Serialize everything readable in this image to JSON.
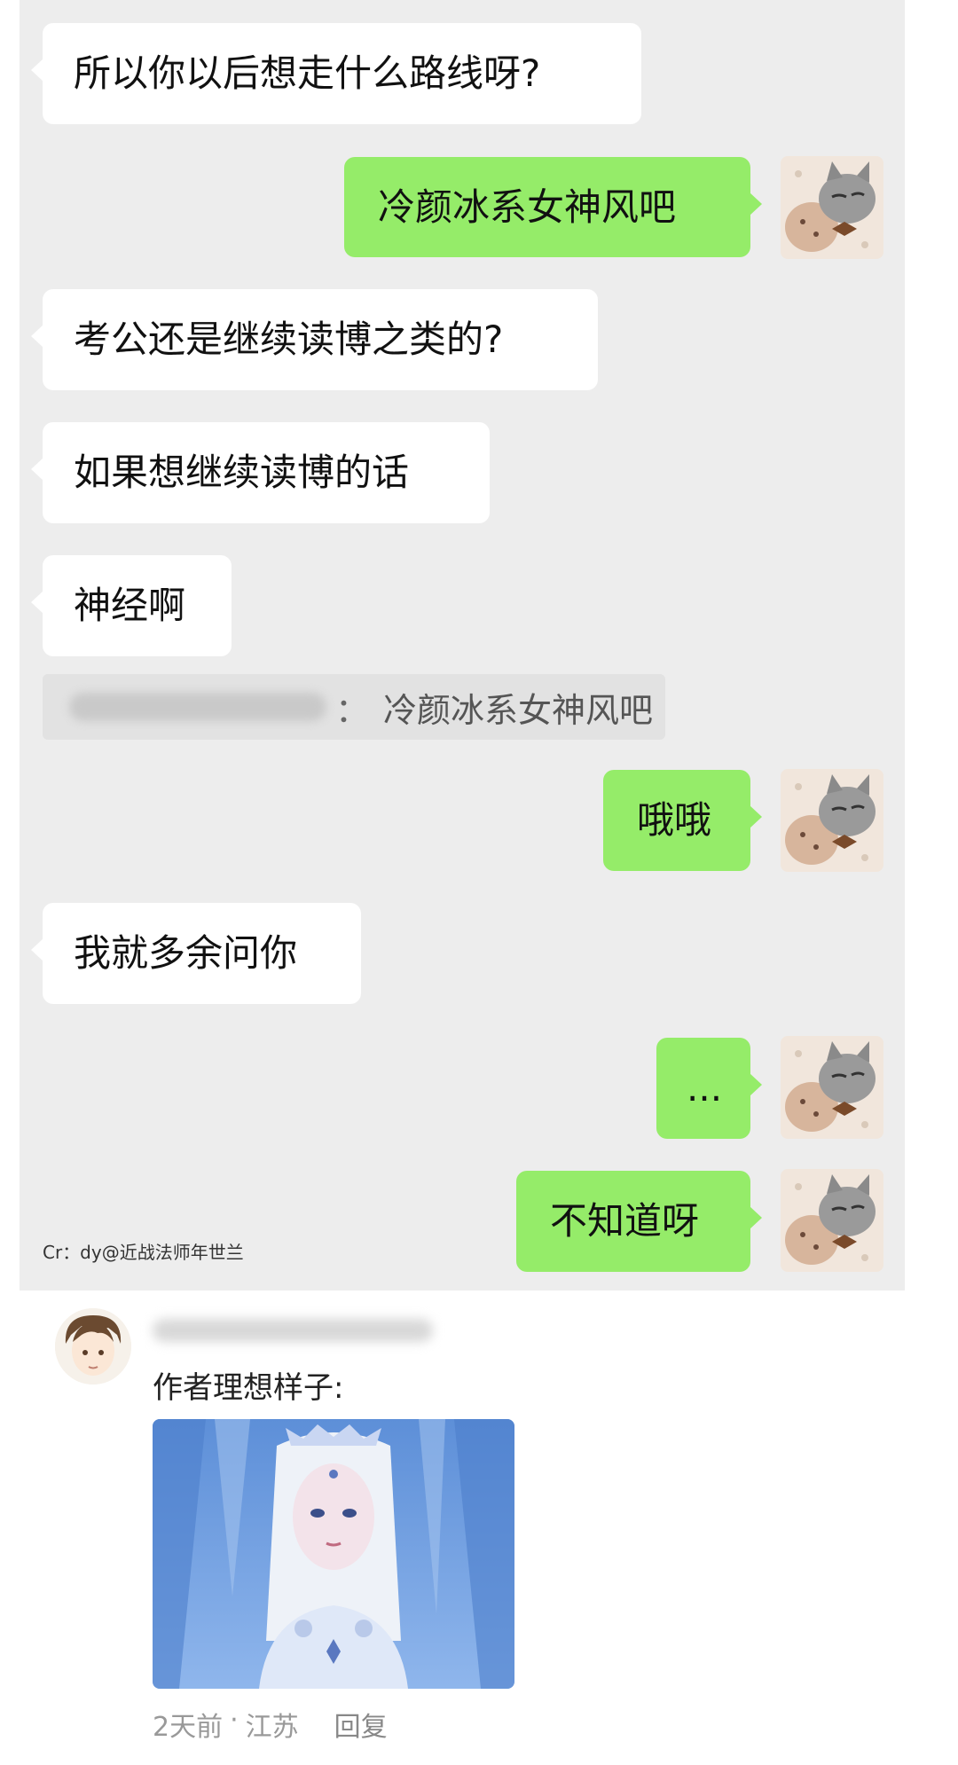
{
  "chat": {
    "messages": [
      {
        "side": "left",
        "text": "所以你以后想走什么路线呀?"
      },
      {
        "side": "right",
        "text": "冷颜冰系女神风吧"
      },
      {
        "side": "left",
        "text": "考公还是继续读博之类的?"
      },
      {
        "side": "left",
        "text": "如果想继续读博的话"
      },
      {
        "side": "left",
        "text": "神经啊"
      },
      {
        "side": "right",
        "text": "哦哦"
      },
      {
        "side": "left",
        "text": "我就多余问你"
      },
      {
        "side": "right",
        "text": "..."
      },
      {
        "side": "right",
        "text": "不知道呀"
      }
    ],
    "quote": {
      "separator": "：",
      "text": "冷颜冰系女神风吧"
    },
    "credit": "Cr：dy@近战法师年世兰",
    "colors": {
      "bubble_right": "#95ec69",
      "bubble_left": "#ffffff",
      "background": "#ededed"
    }
  },
  "comment": {
    "text": "作者理想样子:",
    "time": "2天前",
    "separator": "·",
    "location": "江苏",
    "reply_label": "回复"
  }
}
